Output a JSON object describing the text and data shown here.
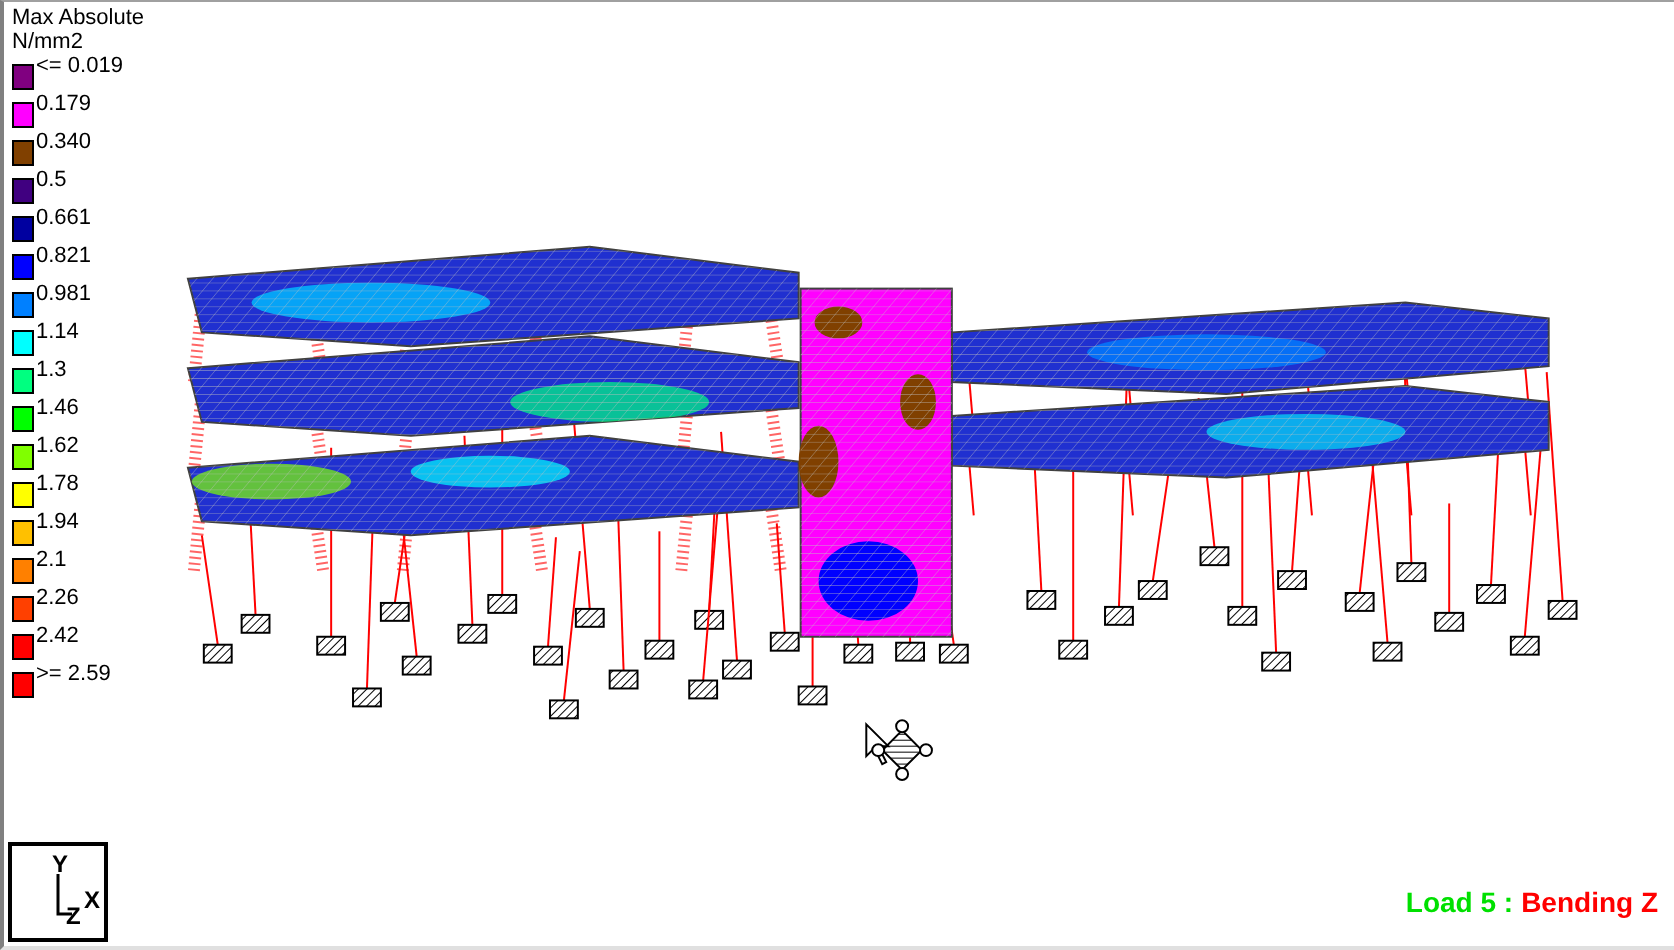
{
  "legend": {
    "title": "Max Absolute",
    "unit": "N/mm2",
    "entries": [
      {
        "label": "<= 0.019",
        "color": "#800080"
      },
      {
        "label": "0.179",
        "color": "#ff00ff"
      },
      {
        "label": "0.340",
        "color": "#804000"
      },
      {
        "label": "0.5",
        "color": "#400080"
      },
      {
        "label": "0.661",
        "color": "#0000a0"
      },
      {
        "label": "0.821",
        "color": "#0000ff"
      },
      {
        "label": "0.981",
        "color": "#0080ff"
      },
      {
        "label": "1.14",
        "color": "#00ffff"
      },
      {
        "label": "1.3",
        "color": "#00ff80"
      },
      {
        "label": "1.46",
        "color": "#00ff00"
      },
      {
        "label": "1.62",
        "color": "#80ff00"
      },
      {
        "label": "1.78",
        "color": "#ffff00"
      },
      {
        "label": "1.94",
        "color": "#ffc000"
      },
      {
        "label": "2.1",
        "color": "#ff8000"
      },
      {
        "label": "2.26",
        "color": "#ff4000"
      },
      {
        "label": "2.42",
        "color": "#ff0000"
      },
      {
        "label": ">= 2.59",
        "color": "#ff0000"
      }
    ]
  },
  "axes": {
    "y": "Y",
    "z": "Z",
    "x": "X"
  },
  "caption": {
    "load": "Load 5 :",
    "result": "Bending Z"
  }
}
